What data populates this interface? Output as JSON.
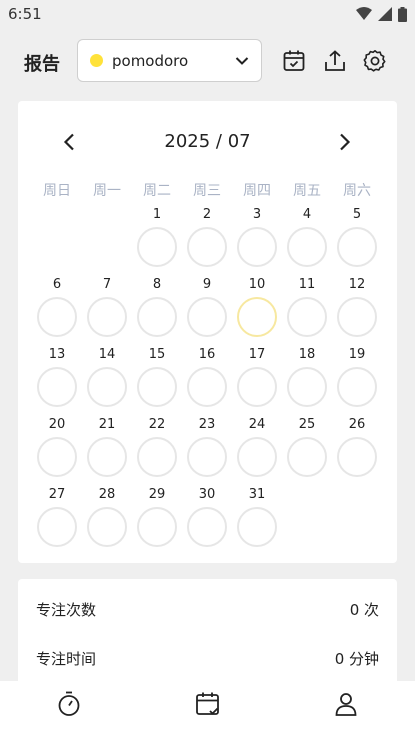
{
  "status": {
    "time": "6:51"
  },
  "header": {
    "title": "报告",
    "project": {
      "name": "pomodoro",
      "color": "#ffe23a"
    }
  },
  "calendar": {
    "month_label": "2025 / 07",
    "weekdays": [
      "周日",
      "周一",
      "周二",
      "周三",
      "周四",
      "周五",
      "周六"
    ],
    "first_weekday_index": 2,
    "days_in_month": 31,
    "today": 10,
    "day_labels": [
      "1",
      "2",
      "3",
      "4",
      "5",
      "6",
      "7",
      "8",
      "9",
      "10",
      "11",
      "12",
      "13",
      "14",
      "15",
      "16",
      "17",
      "18",
      "19",
      "20",
      "21",
      "22",
      "23",
      "24",
      "25",
      "26",
      "27",
      "28",
      "29",
      "30",
      "31"
    ]
  },
  "stats": [
    {
      "label": "专注次数",
      "value": "0 次"
    },
    {
      "label": "专注时间",
      "value": "0 分钟"
    }
  ],
  "colors": {
    "accent": "#ffe23a",
    "today_ring": "#f7e8a0",
    "weekday_text": "#aab3c5"
  }
}
